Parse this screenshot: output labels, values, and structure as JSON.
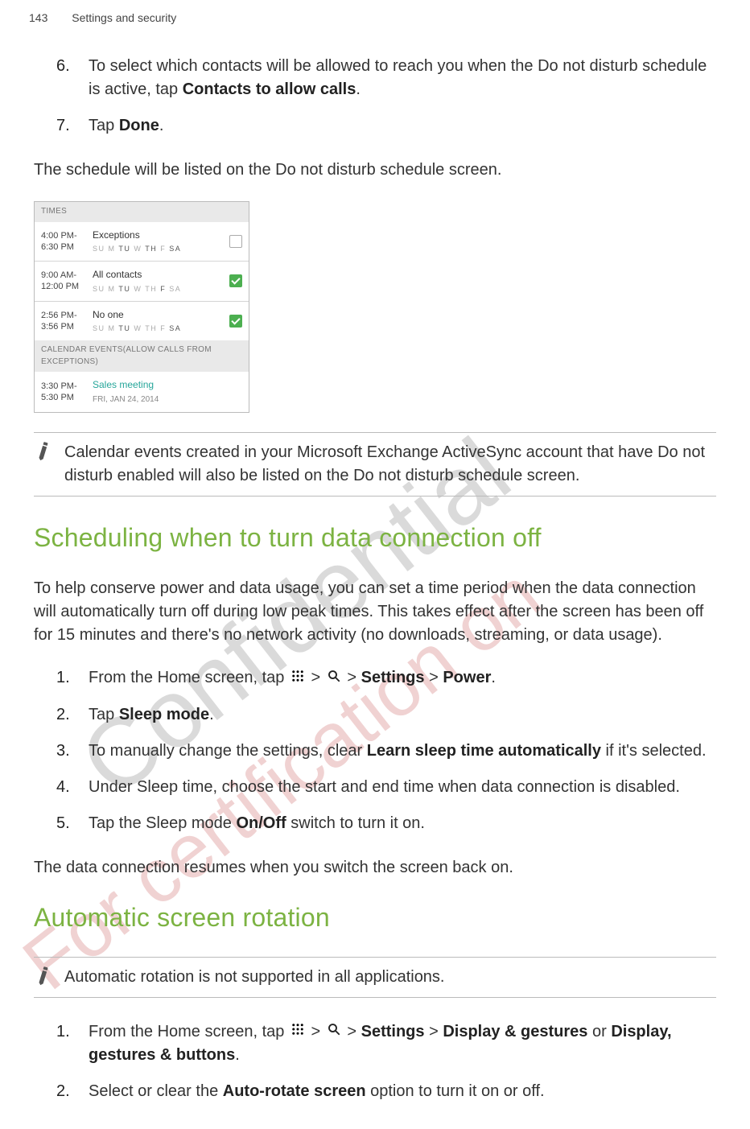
{
  "header": {
    "page_number": "143",
    "title": "Settings and security"
  },
  "section0": {
    "steps": [
      {
        "num": "6.",
        "pre": "To select which contacts will be allowed to reach you when the Do not disturb schedule is active, tap ",
        "bold": "Contacts to allow calls",
        "post": "."
      },
      {
        "num": "7.",
        "pre": "Tap ",
        "bold": "Done",
        "post": "."
      }
    ],
    "after": "The schedule will be listed on the Do not disturb schedule screen."
  },
  "screenshot": {
    "header_times": "TIMES",
    "header_calendar": "CALENDAR EVENTS(ALLOW CALLS FROM EXCEPTIONS)",
    "rows": [
      {
        "time1": "4:00 PM-",
        "time2": "6:30 PM",
        "title": "Exceptions",
        "days_on": [
          "TU",
          "TH",
          "SA"
        ],
        "checked": false
      },
      {
        "time1": "9:00 AM-",
        "time2": "12:00 PM",
        "title": "All contacts",
        "days_on": [
          "TU",
          "F"
        ],
        "checked": true
      },
      {
        "time1": "2:56 PM-",
        "time2": "3:56 PM",
        "title": "No one",
        "days_on": [
          "TU",
          "SA"
        ],
        "checked": true
      }
    ],
    "days_all": [
      "SU",
      "M",
      "TU",
      "W",
      "TH",
      "F",
      "SA"
    ],
    "cal_event": {
      "time1": "3:30 PM-",
      "time2": "5:30 PM",
      "title": "Sales meeting",
      "date": "FRI, JAN 24, 2014"
    }
  },
  "note1": "Calendar events created in your Microsoft Exchange ActiveSync account that have Do not disturb enabled will also be listed on the Do not disturb schedule screen.",
  "section1": {
    "title": "Scheduling when to turn data connection off",
    "intro": "To help conserve power and data usage, you can set a time period when the data connection will automatically turn off during low peak times. This takes effect after the screen has been off for 15 minutes and there's no network activity (no downloads, streaming, or data usage).",
    "steps": [
      {
        "num": "1.",
        "pre": "From the Home screen, tap ",
        "post_nav_1": " > ",
        "post_nav_2": " > ",
        "bold1": "Settings",
        "mid": " > ",
        "bold2": "Power",
        "end": "."
      },
      {
        "num": "2.",
        "pre": "Tap ",
        "bold": "Sleep mode",
        "post": "."
      },
      {
        "num": "3.",
        "pre": "To manually change the settings, clear ",
        "bold": "Learn sleep time automatically",
        "post": " if it's selected."
      },
      {
        "num": "4.",
        "pre": "Under Sleep time, choose the start and end time when data connection is disabled."
      },
      {
        "num": "5.",
        "pre": "Tap the Sleep mode ",
        "bold": "On/Off",
        "post": " switch to turn it on."
      }
    ],
    "after": "The data connection resumes when you switch the screen back on."
  },
  "section2": {
    "title": "Automatic screen rotation",
    "note": "Automatic rotation is not supported in all applications.",
    "steps": [
      {
        "num": "1.",
        "pre": "From the Home screen, tap ",
        "post_nav_1": " > ",
        "post_nav_2": " > ",
        "bold1": "Settings",
        "mid": " > ",
        "bold2": "Display & gestures",
        "or": " or ",
        "bold3": "Display, gestures & buttons",
        "end": "."
      },
      {
        "num": "2.",
        "pre": "Select or clear the ",
        "bold": "Auto-rotate screen",
        "post": " option to turn it on or off."
      }
    ]
  },
  "watermark1": "Confidential",
  "watermark2": "For certification on"
}
